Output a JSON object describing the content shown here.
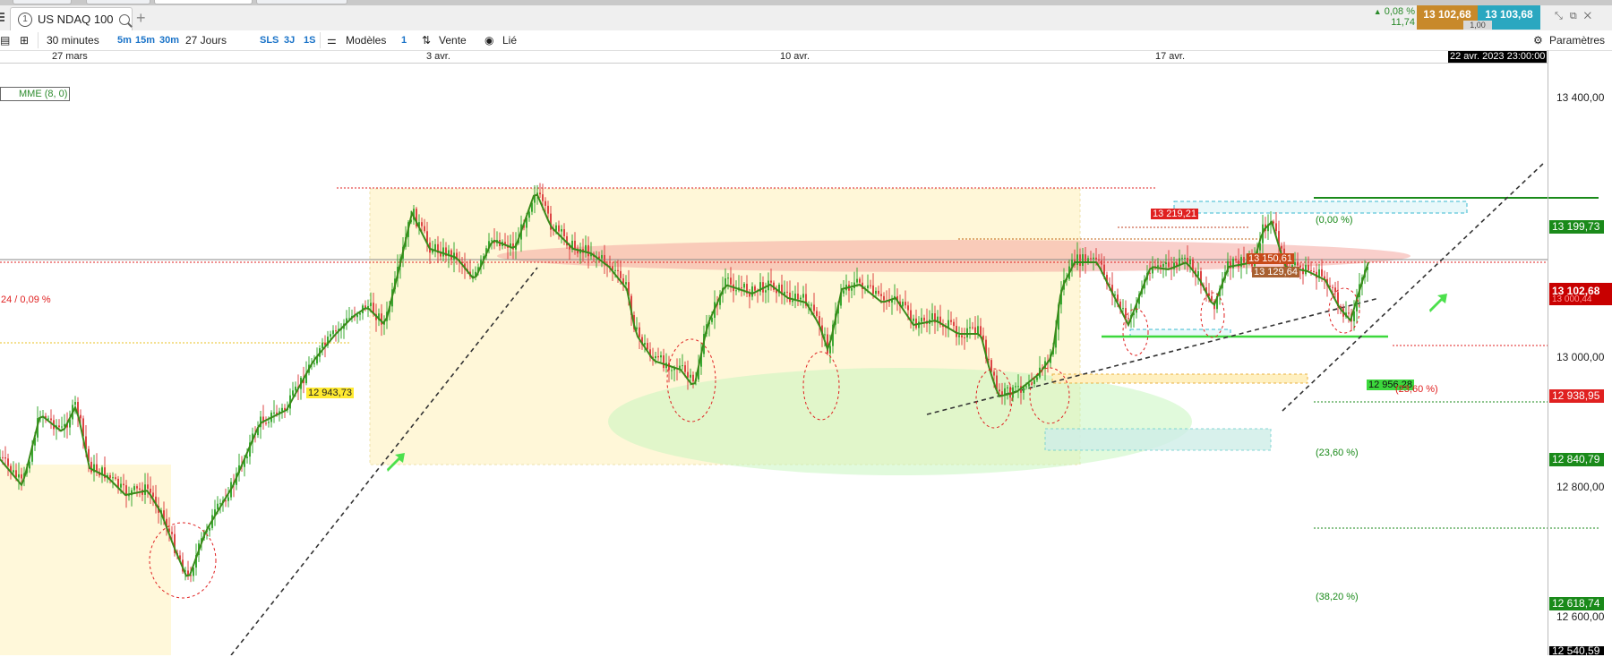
{
  "tabbar": {
    "symbol": "US NDAQ 100",
    "add_tab": "+",
    "change_pct": "0,08 %",
    "change_abs": "11,74",
    "bid": "13 102,68",
    "ask": "13 103,68",
    "spread": "1,00"
  },
  "toolbar": {
    "interval": "30 minutes",
    "quick_intervals": [
      "5m",
      "15m",
      "30m"
    ],
    "period": "27 Jours",
    "quick_periods": [
      "SLS",
      "3J",
      "1S"
    ],
    "models": "Modèles",
    "count": "1",
    "sell": "Vente",
    "linked": "Lié",
    "settings": "Paramètres"
  },
  "xaxis": {
    "labels": [
      "27 mars",
      "3 avr.",
      "10 avr.",
      "17 avr."
    ],
    "crosshair_time": "22 avr. 2023 23:00:00"
  },
  "indicator": "MME (8, 0)",
  "yaxis": {
    "ticks": [
      "13 400,00",
      "13 000,00",
      "12 800,00",
      "12 600,00"
    ],
    "bottom_label": "12 540,59",
    "current_price": "13 102,68",
    "current_price_sub": "13 000,44",
    "levels": [
      {
        "text": "13 199,73",
        "color": "#1a8a1a"
      },
      {
        "text": "12 938,95",
        "color": "#e02020"
      },
      {
        "text": "12 840,79",
        "color": "#1a8a1a"
      },
      {
        "text": "12 618,74",
        "color": "#1a8a1a"
      }
    ]
  },
  "annotations": {
    "left_pct": "24 / 0,09 %",
    "level_12943": "12 943,73",
    "level_13219": "13 219,21",
    "level_13150": "13 150,61",
    "level_13129": "13 129,64",
    "level_12956": "12 956,28",
    "fib_0": "(0,00 %)",
    "fib_23_top": "(23,60 %)",
    "fib_23": "(23,60 %)",
    "fib_38": "(38,20 %)"
  },
  "colors": {
    "accent_bid": "#c8892a",
    "accent_ask": "#2aa7c0",
    "price_up": "#2e8b2e",
    "price_down": "#e02020"
  }
}
